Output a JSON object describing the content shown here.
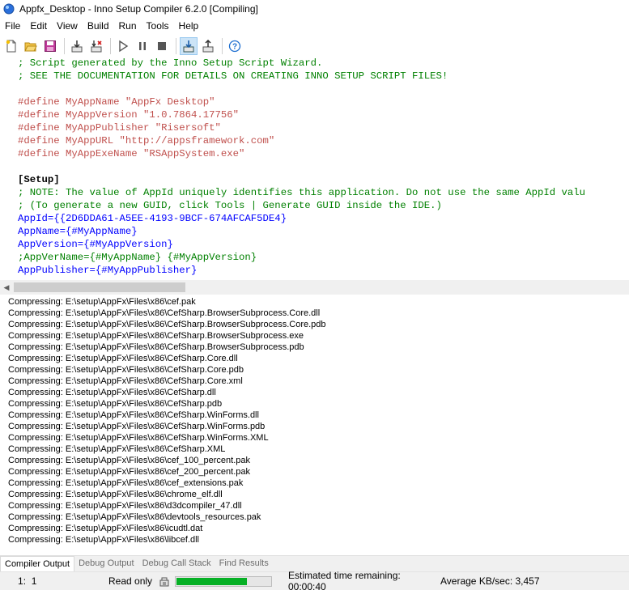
{
  "window": {
    "title": "Appfx_Desktop - Inno Setup Compiler 6.2.0  [Compiling]"
  },
  "menu": [
    "File",
    "Edit",
    "View",
    "Build",
    "Run",
    "Tools",
    "Help"
  ],
  "toolbar_icons": [
    "new-file-icon",
    "open-file-icon",
    "save-icon",
    "compile-icon",
    "stop-compile-icon",
    "run-icon",
    "pause-icon",
    "terminate-icon",
    "target-setup-icon",
    "target-uninstall-icon",
    "help-icon"
  ],
  "editor": {
    "lines": [
      "; Script generated by the Inno Setup Script Wizard.",
      "; SEE THE DOCUMENTATION FOR DETAILS ON CREATING INNO SETUP SCRIPT FILES!",
      "",
      "#define MyAppName \"AppFx Desktop\"",
      "#define MyAppVersion \"1.0.7864.17756\"",
      "#define MyAppPublisher \"Risersoft\"",
      "#define MyAppURL \"http://appsframework.com\"",
      "#define MyAppExeName \"RSAppSystem.exe\"",
      "",
      "[Setup]",
      "; NOTE: The value of AppId uniquely identifies this application. Do not use the same AppId valu",
      "; (To generate a new GUID, click Tools | Generate GUID inside the IDE.)",
      "AppId={{2D6DDA61-A5EE-4193-9BCF-674AFCAF5DE4}",
      "AppName={#MyAppName}",
      "AppVersion={#MyAppVersion}",
      ";AppVerName={#MyAppName} {#MyAppVersion}",
      "AppPublisher={#MyAppPublisher}"
    ]
  },
  "output": {
    "lines": [
      "Compressing: E:\\setup\\AppFx\\Files\\x86\\cef.pak",
      "Compressing: E:\\setup\\AppFx\\Files\\x86\\CefSharp.BrowserSubprocess.Core.dll",
      "Compressing: E:\\setup\\AppFx\\Files\\x86\\CefSharp.BrowserSubprocess.Core.pdb",
      "Compressing: E:\\setup\\AppFx\\Files\\x86\\CefSharp.BrowserSubprocess.exe",
      "Compressing: E:\\setup\\AppFx\\Files\\x86\\CefSharp.BrowserSubprocess.pdb",
      "Compressing: E:\\setup\\AppFx\\Files\\x86\\CefSharp.Core.dll",
      "Compressing: E:\\setup\\AppFx\\Files\\x86\\CefSharp.Core.pdb",
      "Compressing: E:\\setup\\AppFx\\Files\\x86\\CefSharp.Core.xml",
      "Compressing: E:\\setup\\AppFx\\Files\\x86\\CefSharp.dll",
      "Compressing: E:\\setup\\AppFx\\Files\\x86\\CefSharp.pdb",
      "Compressing: E:\\setup\\AppFx\\Files\\x86\\CefSharp.WinForms.dll",
      "Compressing: E:\\setup\\AppFx\\Files\\x86\\CefSharp.WinForms.pdb",
      "Compressing: E:\\setup\\AppFx\\Files\\x86\\CefSharp.WinForms.XML",
      "Compressing: E:\\setup\\AppFx\\Files\\x86\\CefSharp.XML",
      "Compressing: E:\\setup\\AppFx\\Files\\x86\\cef_100_percent.pak",
      "Compressing: E:\\setup\\AppFx\\Files\\x86\\cef_200_percent.pak",
      "Compressing: E:\\setup\\AppFx\\Files\\x86\\cef_extensions.pak",
      "Compressing: E:\\setup\\AppFx\\Files\\x86\\chrome_elf.dll",
      "Compressing: E:\\setup\\AppFx\\Files\\x86\\d3dcompiler_47.dll",
      "Compressing: E:\\setup\\AppFx\\Files\\x86\\devtools_resources.pak",
      "Compressing: E:\\setup\\AppFx\\Files\\x86\\icudtl.dat",
      "Compressing: E:\\setup\\AppFx\\Files\\x86\\libcef.dll"
    ]
  },
  "tabs": [
    "Compiler Output",
    "Debug Output",
    "Debug Call Stack",
    "Find Results"
  ],
  "status": {
    "line": "1",
    "col": "1",
    "mode": "Read only",
    "progress": 0.75,
    "eta": "Estimated time remaining: 00:00:40",
    "avg": "Average KB/sec: 3,457"
  },
  "colors": {
    "comment": "#008000",
    "directive": "#c0504d",
    "key": "#0000ff",
    "progress": "#06b025"
  }
}
